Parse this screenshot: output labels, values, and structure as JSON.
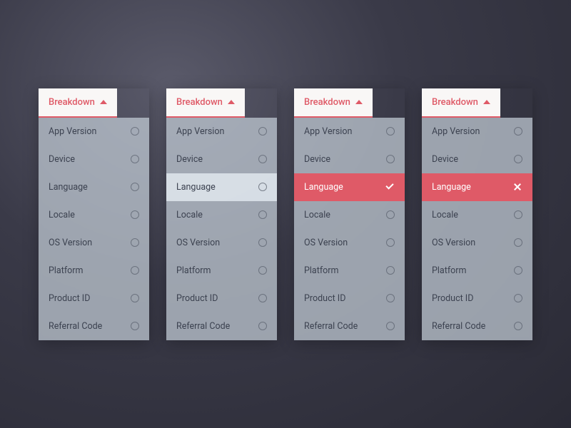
{
  "dropdowns": [
    {
      "title": "Breakdown",
      "items": [
        {
          "label": "App Version",
          "state": "default"
        },
        {
          "label": "Device",
          "state": "default"
        },
        {
          "label": "Language",
          "state": "default"
        },
        {
          "label": "Locale",
          "state": "default"
        },
        {
          "label": "OS Version",
          "state": "default"
        },
        {
          "label": "Platform",
          "state": "default"
        },
        {
          "label": "Product ID",
          "state": "default"
        },
        {
          "label": "Referral Code",
          "state": "default"
        }
      ]
    },
    {
      "title": "Breakdown",
      "items": [
        {
          "label": "App Version",
          "state": "default"
        },
        {
          "label": "Device",
          "state": "default"
        },
        {
          "label": "Language",
          "state": "hover"
        },
        {
          "label": "Locale",
          "state": "default"
        },
        {
          "label": "OS Version",
          "state": "default"
        },
        {
          "label": "Platform",
          "state": "default"
        },
        {
          "label": "Product ID",
          "state": "default"
        },
        {
          "label": "Referral Code",
          "state": "default"
        }
      ]
    },
    {
      "title": "Breakdown",
      "items": [
        {
          "label": "App Version",
          "state": "default"
        },
        {
          "label": "Device",
          "state": "default"
        },
        {
          "label": "Language",
          "state": "selected-check"
        },
        {
          "label": "Locale",
          "state": "default"
        },
        {
          "label": "OS Version",
          "state": "default"
        },
        {
          "label": "Platform",
          "state": "default"
        },
        {
          "label": "Product ID",
          "state": "default"
        },
        {
          "label": "Referral Code",
          "state": "default"
        }
      ]
    },
    {
      "title": "Breakdown",
      "items": [
        {
          "label": "App Version",
          "state": "default"
        },
        {
          "label": "Device",
          "state": "default"
        },
        {
          "label": "Language",
          "state": "selected-close"
        },
        {
          "label": "Locale",
          "state": "default"
        },
        {
          "label": "OS Version",
          "state": "default"
        },
        {
          "label": "Platform",
          "state": "default"
        },
        {
          "label": "Product ID",
          "state": "default"
        },
        {
          "label": "Referral Code",
          "state": "default"
        }
      ]
    }
  ]
}
